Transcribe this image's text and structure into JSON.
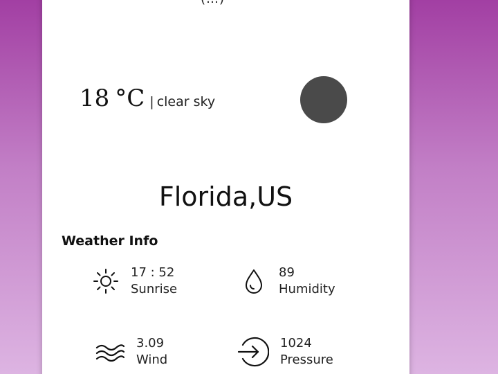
{
  "header": {
    "partial_text": "(…)"
  },
  "current": {
    "temperature": "18",
    "unit": "°C",
    "separator": "|",
    "description": "clear sky",
    "icon": "weather-icon-placeholder"
  },
  "location": {
    "city": "Florida,US"
  },
  "weather_info": {
    "title": "Weather Info",
    "items": [
      {
        "value": "17 : 52",
        "label": "Sunrise",
        "icon": "sun-icon"
      },
      {
        "value": "89",
        "label": "Humidity",
        "icon": "droplet-icon"
      },
      {
        "value": "3.09",
        "label": "Wind",
        "icon": "wind-icon"
      },
      {
        "value": "1024",
        "label": "Pressure",
        "icon": "pressure-icon"
      }
    ]
  },
  "colors": {
    "background_top": "#a23fa3",
    "background_bottom": "#ddb4e2",
    "card": "#ffffff",
    "icon_circle": "#4a4a4a"
  }
}
